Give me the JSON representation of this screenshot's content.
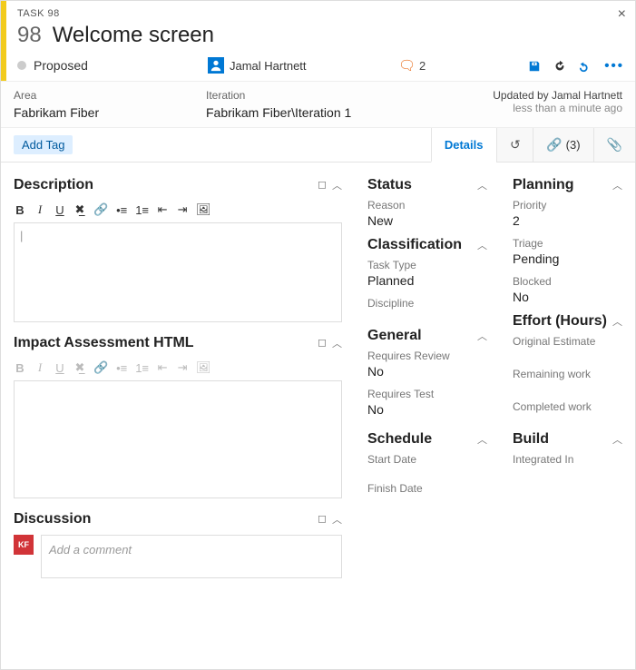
{
  "header": {
    "type_label": "TASK 98",
    "id": "98",
    "title": "Welcome screen",
    "state": "Proposed",
    "assignee": "Jamal Hartnett",
    "comment_count": "2"
  },
  "classification": {
    "area_label": "Area",
    "area_value": "Fabrikam Fiber",
    "iteration_label": "Iteration",
    "iteration_value": "Fabrikam Fiber\\Iteration 1",
    "updated_by": "Updated by Jamal Hartnett",
    "updated_when": "less than a minute ago"
  },
  "tag_button": "Add Tag",
  "tabs": {
    "details": "Details",
    "history_icon": "history",
    "links_count": "(3)",
    "attach_icon": "attachment"
  },
  "left": {
    "description_title": "Description",
    "description_placeholder": "|",
    "impact_title": "Impact Assessment HTML",
    "discussion_title": "Discussion",
    "discussion_placeholder": "Add a comment",
    "discussion_avatar": "KF"
  },
  "mid": {
    "status_title": "Status",
    "reason_label": "Reason",
    "reason_value": "New",
    "classification_title": "Classification",
    "tasktype_label": "Task Type",
    "tasktype_value": "Planned",
    "discipline_label": "Discipline",
    "general_title": "General",
    "reqreview_label": "Requires Review",
    "reqreview_value": "No",
    "reqtest_label": "Requires Test",
    "reqtest_value": "No",
    "schedule_title": "Schedule",
    "start_label": "Start Date",
    "finish_label": "Finish Date"
  },
  "right": {
    "planning_title": "Planning",
    "priority_label": "Priority",
    "priority_value": "2",
    "triage_label": "Triage",
    "triage_value": "Pending",
    "blocked_label": "Blocked",
    "blocked_value": "No",
    "effort_title": "Effort (Hours)",
    "orig_label": "Original Estimate",
    "remain_label": "Remaining work",
    "comp_label": "Completed work",
    "build_title": "Build",
    "integrated_label": "Integrated In"
  }
}
